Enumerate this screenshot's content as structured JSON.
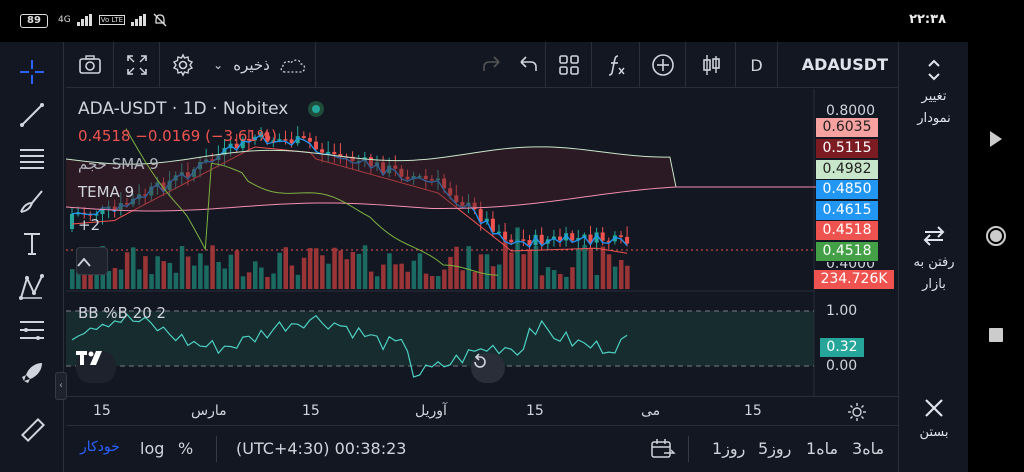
{
  "status_bar": {
    "battery": "89",
    "network": "4G",
    "volte": "Vo LTE",
    "clock": "۲۲:۳۸"
  },
  "toolbar": {
    "save_label": "ذخیره",
    "timeframe": "D",
    "symbol": "ADAUSDT"
  },
  "legend": {
    "title": "ADA-USDT · 1D · Nobitex",
    "ohlc_close": "0.4518",
    "change": "−0.0169 (−3.61%)",
    "ind1": "حجم SMA 9",
    "ind2": "TEMA 9",
    "more": "+2",
    "lower": "BB %B 20 2"
  },
  "price_scale": {
    "top_value": "0.8000",
    "cut_value": "0.4000",
    "tags": [
      {
        "value": "0.6035",
        "color": "#f7a1a1",
        "text_color": "#222"
      },
      {
        "value": "0.5115",
        "color": "#7c1c22",
        "text_color": "#fff"
      },
      {
        "value": "0.4982",
        "color": "#c8e6c9",
        "text_color": "#222"
      },
      {
        "value": "0.4850",
        "color": "#2196f3",
        "text_color": "#fff"
      },
      {
        "value": "0.4615",
        "color": "#2196f3",
        "text_color": "#fff"
      },
      {
        "value": "0.4518",
        "color": "#ef5350",
        "text_color": "#fff"
      },
      {
        "value": "0.4518",
        "color": "#43a047",
        "text_color": "#fff"
      },
      {
        "value": "234.726K",
        "color": "#ef5350",
        "text_color": "#fff"
      }
    ],
    "lower_top": "1.00",
    "lower_current": "0.32",
    "lower_bottom": "0.00"
  },
  "date_axis": [
    "15",
    "مارس",
    "15",
    "آوریل",
    "15",
    "می",
    "15"
  ],
  "bottom_bar": {
    "auto": "خودکار",
    "log": "log",
    "percent": "%",
    "time": "(UTC+4:30) 00:38:23",
    "ranges": [
      "1روز",
      "5روز",
      "1ماه",
      "3ماه"
    ]
  },
  "right_panel": {
    "chart_type_line1": "تغییر",
    "chart_type_line2": "نمودار",
    "market_line1": "رفتن به",
    "market_line2": "بازار",
    "close": "بستن"
  },
  "colors": {
    "bg": "#131722",
    "up": "#26a69a",
    "down": "#ef5350",
    "accent": "#2962ff"
  }
}
